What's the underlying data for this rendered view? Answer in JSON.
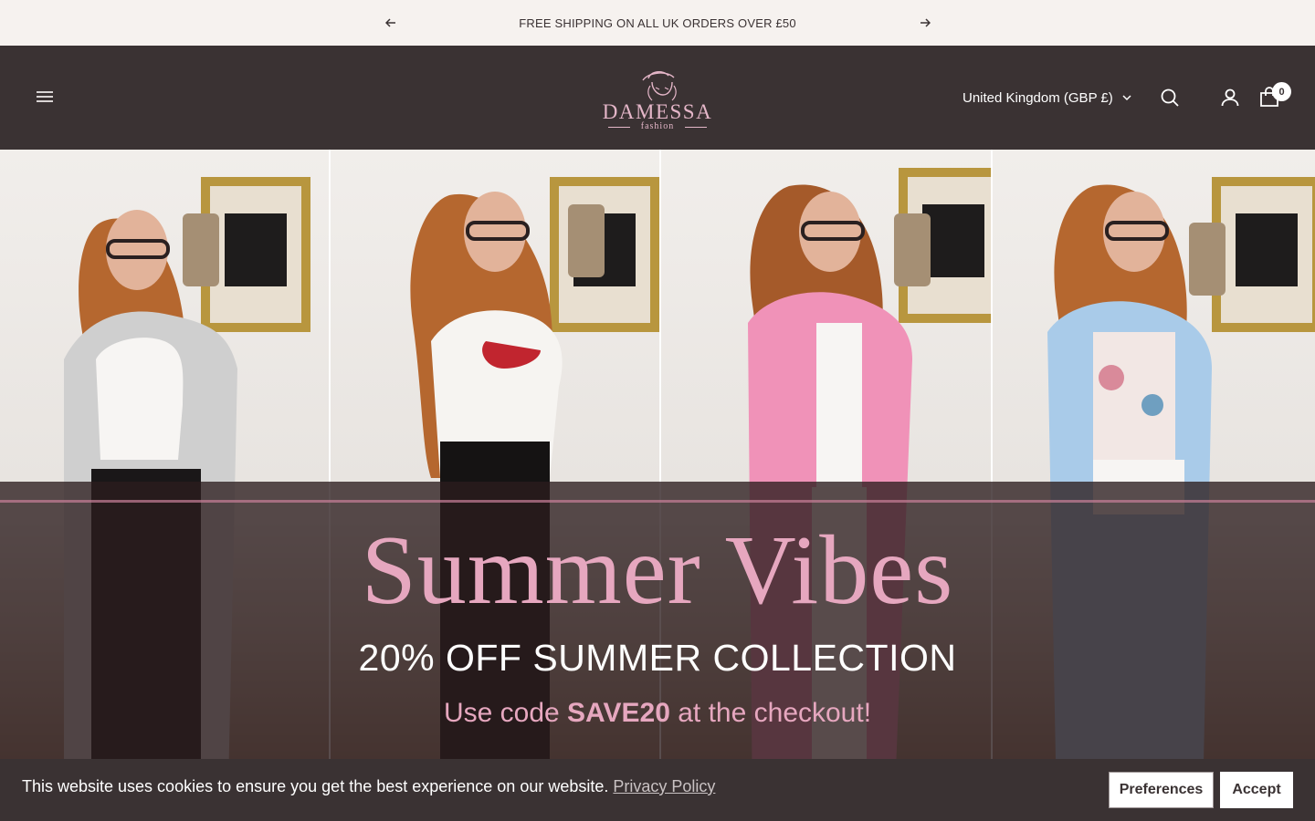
{
  "announcement": {
    "message": "FREE SHIPPING ON ALL UK ORDERS OVER £50",
    "prev_icon": "arrow-left-icon",
    "next_icon": "arrow-right-icon"
  },
  "header": {
    "logo_word": "DAMESSA",
    "logo_sub": "fashion",
    "country_selector": "United Kingdom (GBP £)",
    "cart_count": "0",
    "icons": [
      "menu-icon",
      "search-icon",
      "account-icon",
      "cart-icon"
    ]
  },
  "hero": {
    "title": "Summer Vibes",
    "subtitle": "20% OFF SUMMER COLLECTION",
    "code_prefix": "Use code",
    "code": "SAVE20",
    "code_suffix": "at the checkout!"
  },
  "cookie_banner": {
    "text": "This website uses cookies to ensure you get the best experience on our website.",
    "link": "Privacy Policy",
    "preferences_label": "Preferences",
    "accept_label": "Accept"
  },
  "colors": {
    "header_bg": "#3a3233",
    "announcement_bg": "#f6f2ef",
    "accent_pink": "#e6a7bf"
  }
}
